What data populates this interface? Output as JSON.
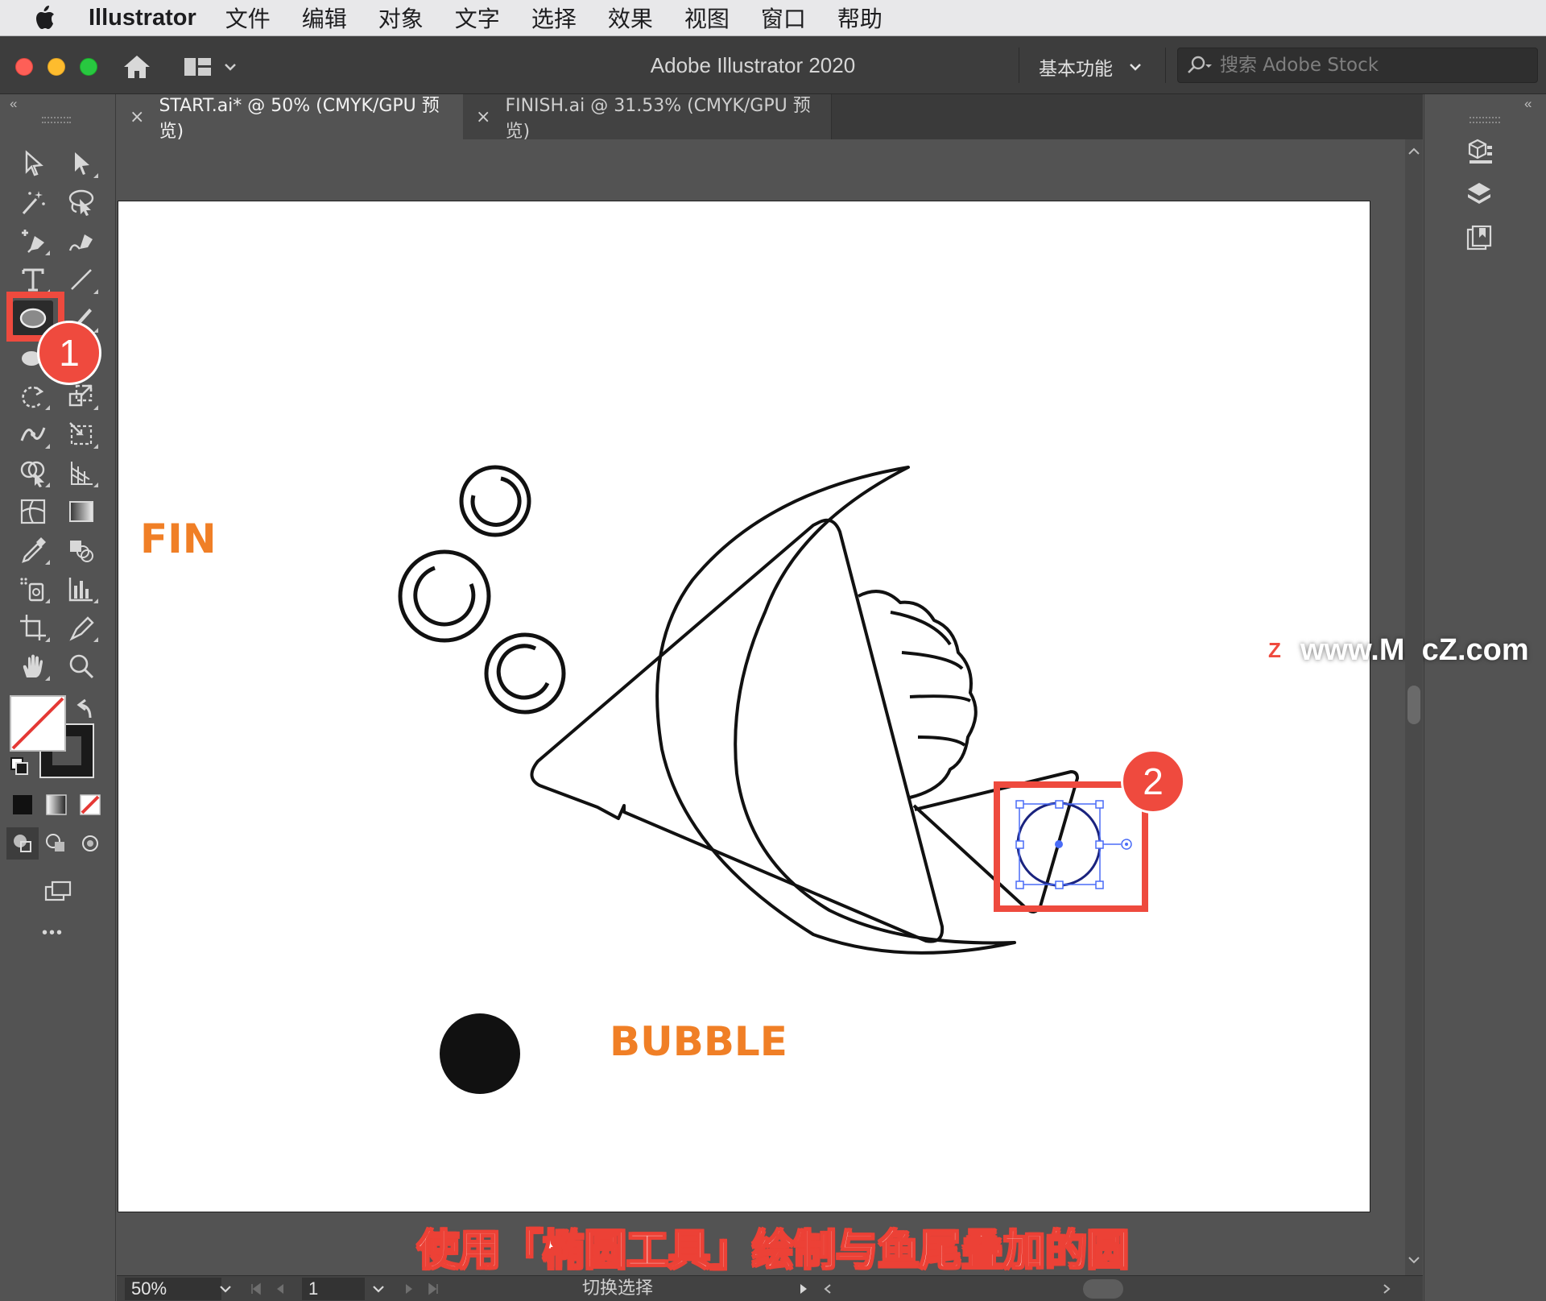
{
  "menubar": {
    "app_name": "Illustrator",
    "items": [
      "文件",
      "编辑",
      "对象",
      "文字",
      "选择",
      "效果",
      "视图",
      "窗口",
      "帮助"
    ]
  },
  "titlebar": {
    "title": "Adobe Illustrator 2020",
    "workspace": "基本功能",
    "search_placeholder": "搜索 Adobe Stock"
  },
  "tabs": [
    {
      "label": "START.ai* @ 50% (CMYK/GPU 预览)",
      "close": "×"
    },
    {
      "label": "FINISH.ai @ 31.53% (CMYK/GPU 预览)",
      "close": "×"
    }
  ],
  "canvas": {
    "label_fin": "FIN",
    "label_bubble": "BUBBLE",
    "fin_color": "#f07f26"
  },
  "callouts": {
    "one": "1",
    "two": "2",
    "color": "#ef4a3e"
  },
  "watermark": {
    "logo": "Z",
    "text": "www.MacZ.com"
  },
  "subtitle": "使用「椭圆工具」绘制与鱼尾叠加的圆",
  "statusbar": {
    "zoom": "50%",
    "page": "1",
    "status": "切换选择"
  },
  "toolbar": {
    "more": "•••"
  }
}
